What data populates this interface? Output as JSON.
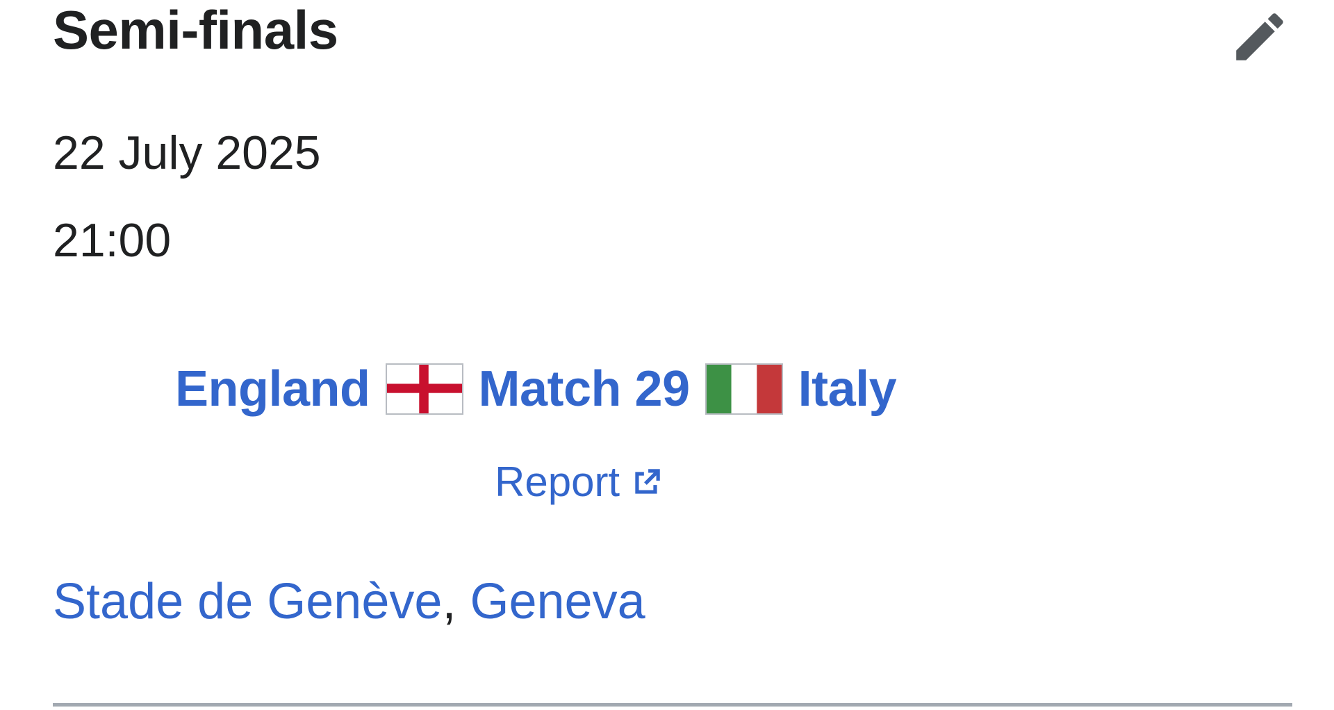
{
  "section": {
    "heading": "Semi-finals",
    "edit_icon": "pencil-icon"
  },
  "match": {
    "date": "22 July 2025",
    "time": "21:00",
    "home_team": "England",
    "home_flag": "england-flag-icon",
    "match_label": "Match 29",
    "away_flag": "italy-flag-icon",
    "away_team": "Italy",
    "report_label": "Report",
    "report_icon": "external-link-icon"
  },
  "venue": {
    "stadium": "Stade de Genève",
    "separator": ",",
    "city": "Geneva"
  },
  "colors": {
    "link": "#3366cc",
    "text": "#202122",
    "england_red": "#c8102e",
    "italy_green": "#009246",
    "italy_red": "#ce2b37",
    "icon_gray": "#54595d"
  }
}
